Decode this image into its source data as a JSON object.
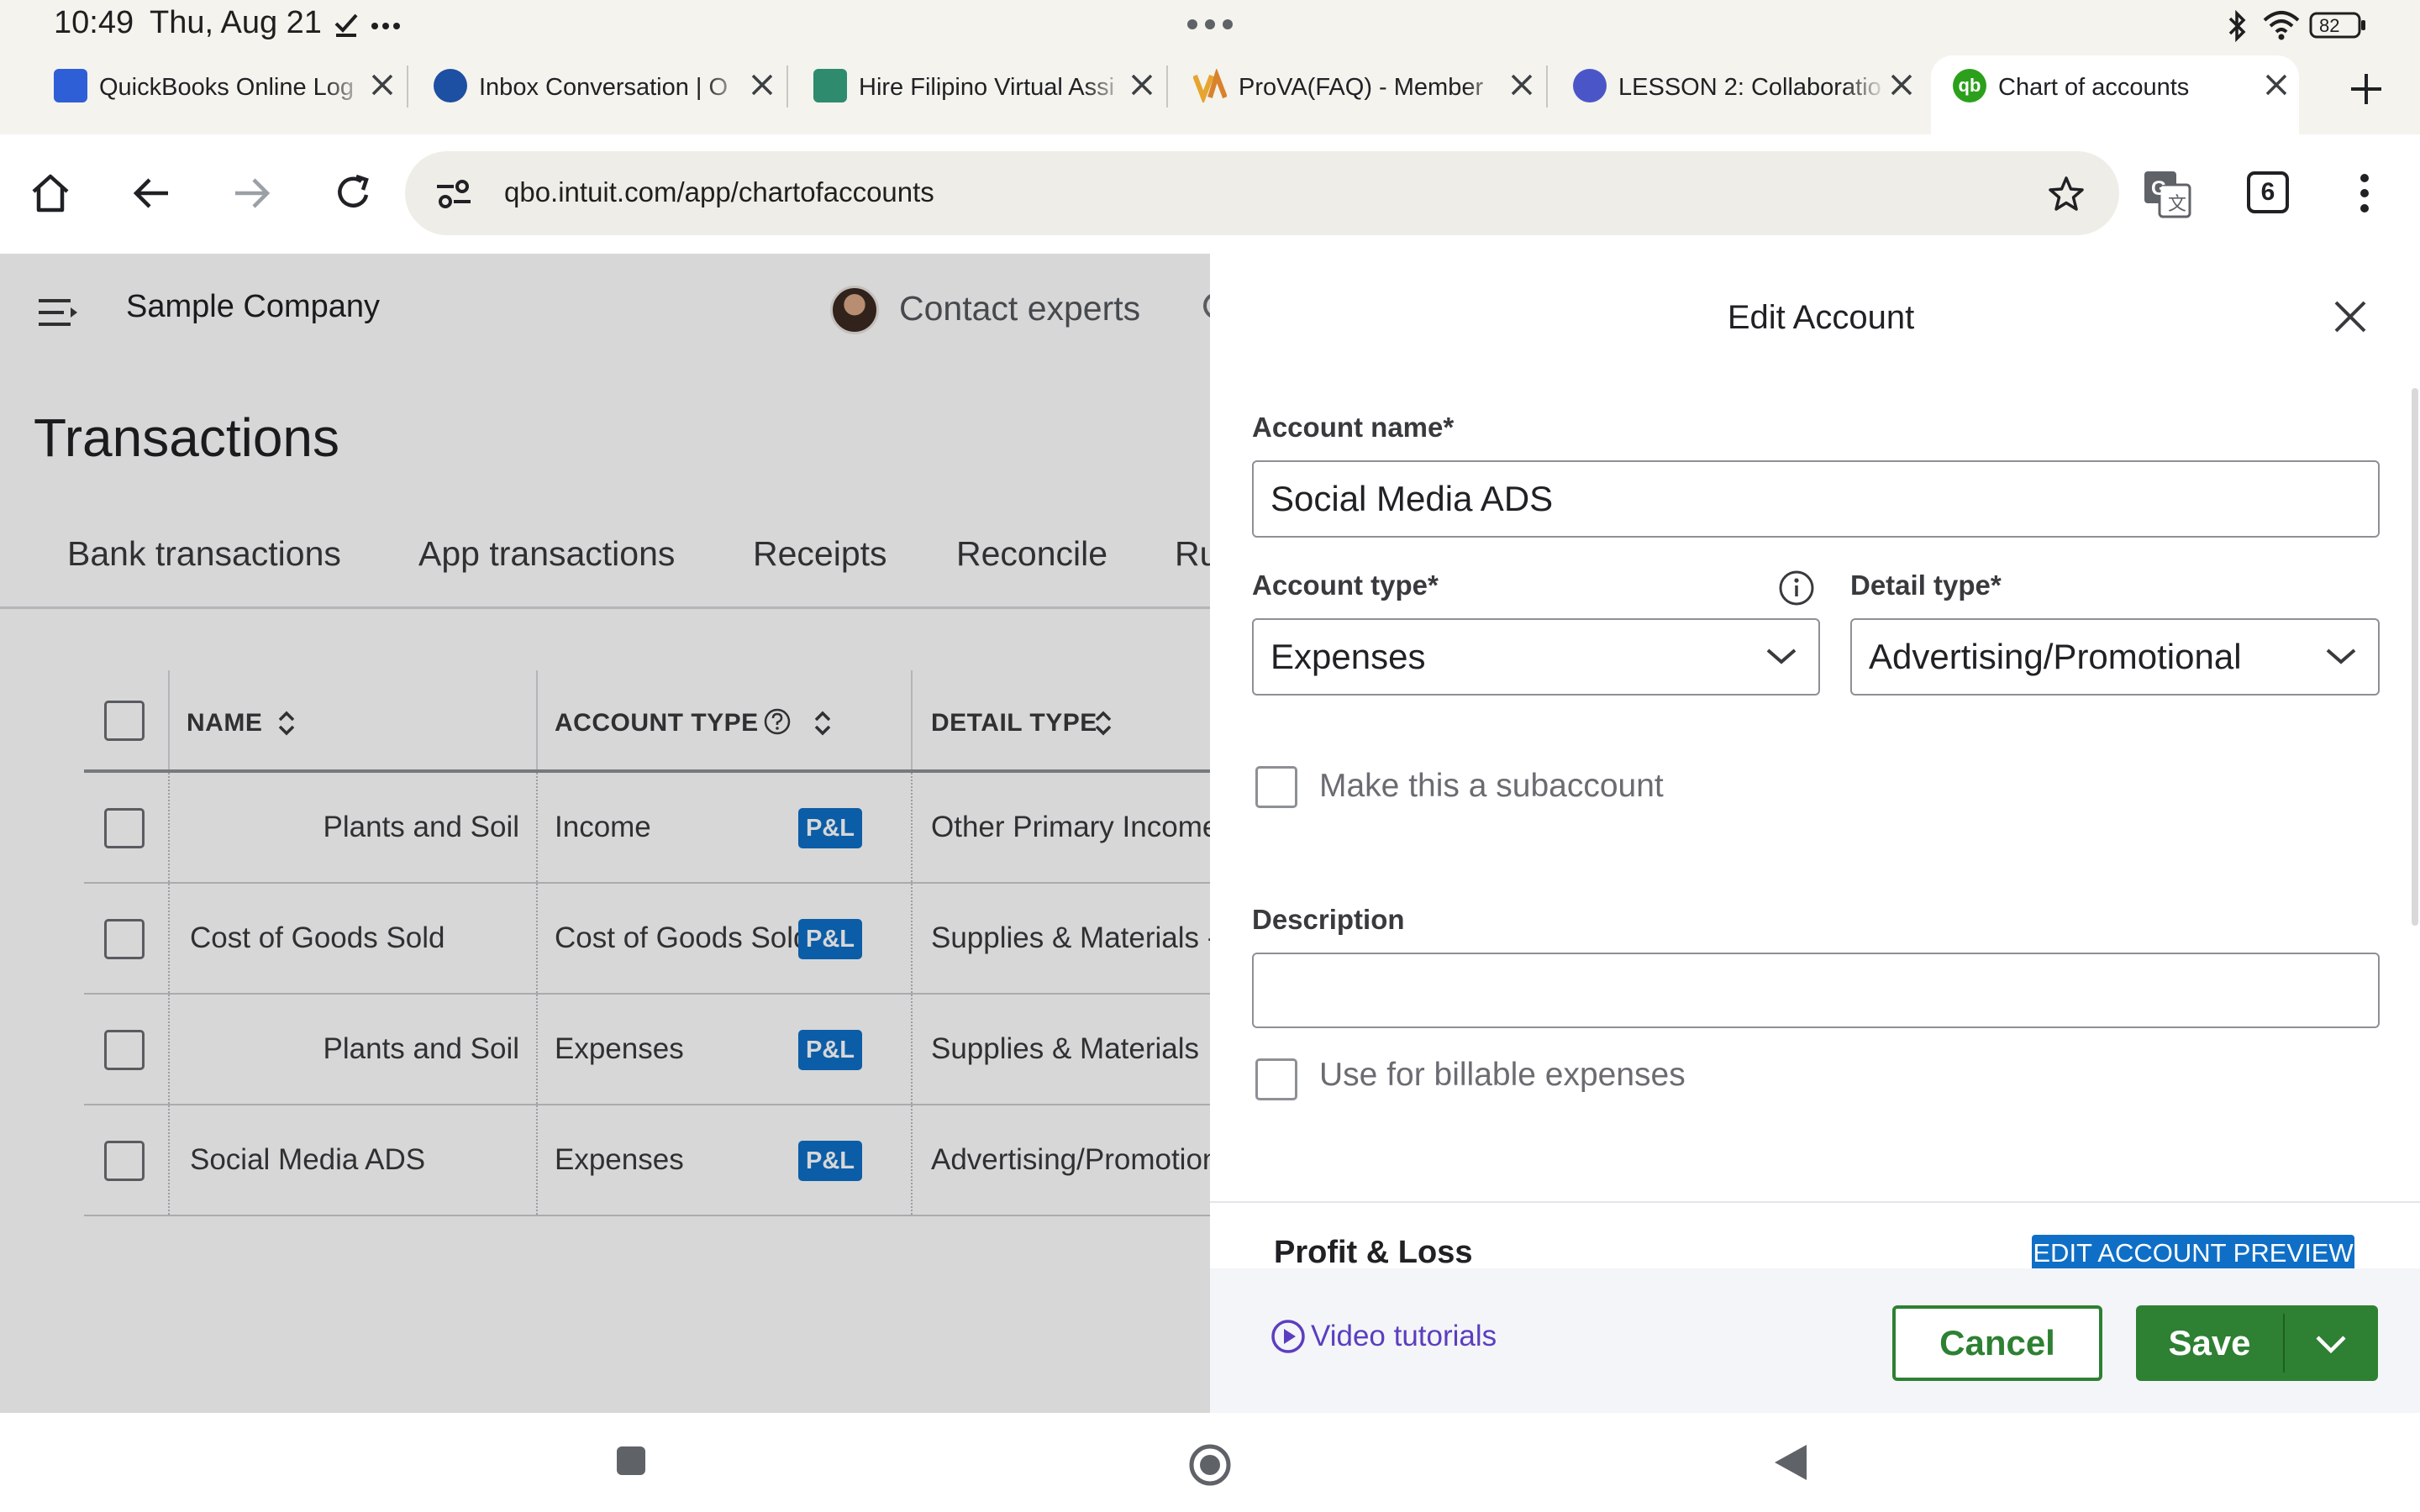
{
  "status_bar": {
    "time": "10:49",
    "date": "Thu, Aug 21",
    "battery": "82"
  },
  "tabs": [
    {
      "title": "QuickBooks Online Log",
      "favicon_color": "#2f5fd6"
    },
    {
      "title": "Inbox Conversation | O",
      "favicon_color": "#1d4fa3"
    },
    {
      "title": "Hire Filipino Virtual Assi",
      "favicon_color": "#2e8b6e"
    },
    {
      "title": "ProVA(FAQ) - Member",
      "favicon_color": "#e5a530"
    },
    {
      "title": "LESSON 2: Collaboratio",
      "favicon_color": "#4a56c8"
    },
    {
      "title": "Chart of accounts",
      "favicon_color": "#2ca01c"
    }
  ],
  "browser": {
    "url": "qbo.intuit.com/app/chartofaccounts",
    "tab_count": "6"
  },
  "app": {
    "company_name": "Sample Company",
    "contact_experts": "Contact experts",
    "page_title": "Transactions",
    "nav_tabs": [
      "Bank transactions",
      "App transactions",
      "Receipts",
      "Reconcile",
      "Ru"
    ],
    "table": {
      "headers": {
        "name": "NAME",
        "account_type": "ACCOUNT TYPE",
        "detail_type": "DETAIL TYPE"
      },
      "badge": "P&L",
      "rows": [
        {
          "name": "Plants and Soil",
          "account_type": "Income",
          "detail_type": "Other Primary Income"
        },
        {
          "name": "Cost of Goods Sold",
          "account_type": "Cost of Goods Sold",
          "detail_type": "Supplies & Materials - C"
        },
        {
          "name": "Plants and Soil",
          "account_type": "Expenses",
          "detail_type": "Supplies & Materials"
        },
        {
          "name": "Social Media ADS",
          "account_type": "Expenses",
          "detail_type": "Advertising/Promotional"
        }
      ]
    }
  },
  "drawer": {
    "title": "Edit Account",
    "account_name_label": "Account name*",
    "account_name_value": "Social Media ADS",
    "account_type_label": "Account type*",
    "account_type_value": "Expenses",
    "detail_type_label": "Detail type*",
    "detail_type_value": "Advertising/Promotional",
    "subaccount_label": "Make this a subaccount",
    "description_label": "Description",
    "description_value": "",
    "billable_label": "Use for billable expenses",
    "pl_section_title": "Profit & Loss",
    "preview_button": "EDIT ACCOUNT PREVIEW",
    "video_tutorials": "Video tutorials",
    "cancel": "Cancel",
    "save": "Save"
  },
  "colors": {
    "qb_green": "#2e8033",
    "pl_badge": "#0f6fc6",
    "link_purple": "#5b3ec0"
  }
}
